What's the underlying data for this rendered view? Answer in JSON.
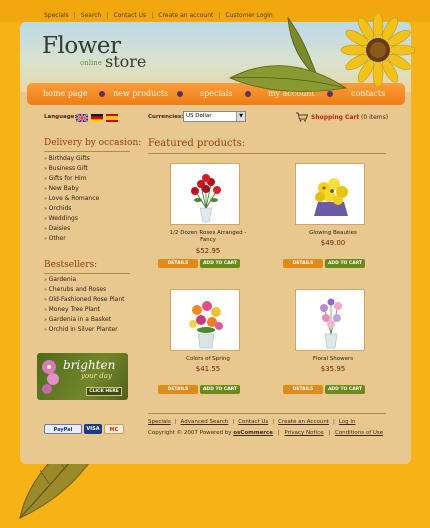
{
  "top_links": [
    "Specials",
    "Search",
    "Contact Us",
    "Create an account",
    "Customer Login"
  ],
  "logo": {
    "title": "Flower",
    "sub_online": "online",
    "sub_store": "store"
  },
  "nav": [
    "home page",
    "new products",
    "specials",
    "my account",
    "contacts"
  ],
  "language": {
    "label": "Language:",
    "flags": [
      "uk-flag-icon",
      "germany-flag-icon",
      "spain-flag-icon"
    ]
  },
  "currencies": {
    "label": "Currencies:",
    "selected": "US Dollar"
  },
  "cart": {
    "label": "Shopping Cart",
    "count": "(0 items)"
  },
  "sidebar": {
    "occasion_heading": "Delivery by occasion:",
    "occasions": [
      "Birthday Gifts",
      "Business Gift",
      "Gifts for Him",
      "New Baby",
      "Love & Romance",
      "Orchids",
      "Weddings",
      "Daisies",
      "Other"
    ],
    "bestsellers_heading": "Bestsellers:",
    "bestsellers": [
      "Gardenia",
      "Cherubs and Roses",
      "Old-Fashioned Rose Plant",
      "Money Tree Plant",
      "Gardenia in a Basket",
      "Orchid in Silver Planter"
    ],
    "promo": {
      "line1": "brighten",
      "line2": "your day",
      "button": "CLICK HERE"
    }
  },
  "featured": {
    "heading": "Featured products:",
    "details_label": "DETAILS",
    "cart_label": "ADD TO CART",
    "products": [
      {
        "name_line1": "1/2 Dozen Roses Arranged -",
        "name_line2": "Fancy",
        "price": "$52.95"
      },
      {
        "name_line1": "Glowing Beauties",
        "name_line2": "",
        "price": "$49.00"
      },
      {
        "name_line1": "Colors of Spring",
        "name_line2": "",
        "price": "$41.55"
      },
      {
        "name_line1": "Floral Showers",
        "name_line2": "",
        "price": "$35.95"
      }
    ]
  },
  "footer": {
    "links": [
      "Specials",
      "Advanced Search",
      "Contact Us",
      "Create an Account",
      "Log In"
    ],
    "copyright_prefix": "Copyright © 2007 Powered by",
    "powered_by": "osCommerce",
    "privacy": "Privacy Notice",
    "conditions": "Conditions of Use",
    "payment": [
      "PayPal",
      "VISA",
      "MC"
    ]
  }
}
